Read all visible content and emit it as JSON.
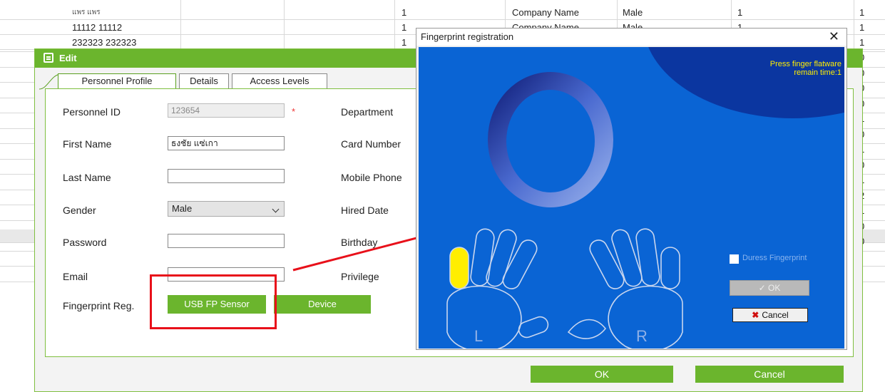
{
  "background_table": {
    "rows": [
      {
        "name": "แพร แพร",
        "c1": "1",
        "company": "Company Name",
        "gender": "Male",
        "c4": "1",
        "c5": "1"
      },
      {
        "name": "11112 11112",
        "c1": "1",
        "company": "Company Name",
        "gender": "Male",
        "c4": "1",
        "c5": "1"
      },
      {
        "name": "232323 232323",
        "c1": "1",
        "company": "",
        "gender": "",
        "c4": "",
        "c5": "1"
      }
    ],
    "right_column": [
      "0",
      "0",
      "0",
      "0",
      "1",
      "0",
      "1",
      "0",
      "1",
      "2",
      "1",
      "0",
      "0"
    ]
  },
  "edit_dialog": {
    "title": "Edit",
    "tabs": [
      "Personnel Profile",
      "Details",
      "Access Levels"
    ],
    "fields": {
      "personnel_id_label": "Personnel ID",
      "personnel_id_value": "123654",
      "required_mark": "*",
      "first_name_label": "First Name",
      "first_name_value": "ธงชัย แซ่เกา",
      "last_name_label": "Last Name",
      "last_name_value": "",
      "gender_label": "Gender",
      "gender_value": "Male",
      "password_label": "Password",
      "password_value": "",
      "email_label": "Email",
      "email_value": "",
      "fingerprint_label": "Fingerprint Reg.",
      "department_label": "Department",
      "card_number_label": "Card Number",
      "mobile_phone_label": "Mobile Phone",
      "hired_date_label": "Hired Date",
      "birthday_label": "Birthday",
      "privilege_label": "Privilege"
    },
    "buttons": {
      "usb_fp_sensor": "USB FP Sensor",
      "device": "Device",
      "ok": "OK",
      "cancel": "Cancel"
    }
  },
  "fingerprint_dialog": {
    "title": "Fingerprint registration",
    "close_glyph": "✕",
    "message_line1": "Press finger flatware",
    "message_line2": "remain time:1",
    "left_hand_label": "L",
    "right_hand_label": "R",
    "duress_label": "Duress Fingerprint",
    "ok_label": "OK",
    "cancel_label": "Cancel",
    "selected_finger": "left-little-finger",
    "selected_color": "#ffee00"
  },
  "annotation": {
    "highlight_color": "#e8101a"
  }
}
